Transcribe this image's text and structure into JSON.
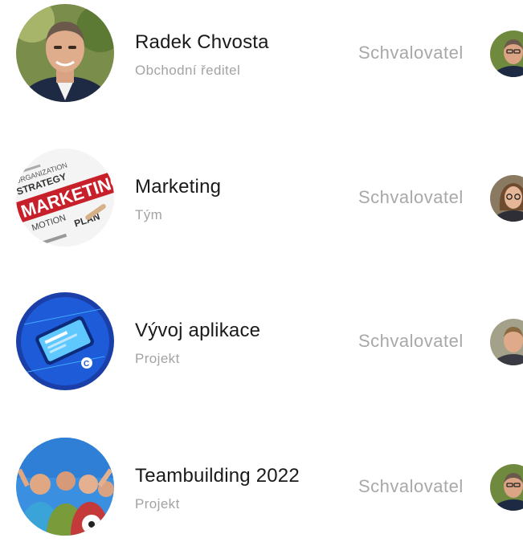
{
  "items": [
    {
      "title": "Radek Chvosta",
      "subtitle": "Obchodní ředitel",
      "role": "Schvalovatel",
      "avatar": "person-photo",
      "approver_avatar": "man-avatar"
    },
    {
      "title": "Marketing",
      "subtitle": "Tým",
      "role": "Schvalovatel",
      "avatar": "marketing-word-cloud",
      "approver_avatar": "woman-avatar",
      "avatar_words": [
        "MARKETING",
        "STRATEGY",
        "ORGANIZATION",
        "PLAN",
        "MOTION"
      ]
    },
    {
      "title": "Vývoj aplikace",
      "subtitle": "Projekt",
      "role": "Schvalovatel",
      "avatar": "phone-app-illustration",
      "approver_avatar": "man-avatar"
    },
    {
      "title": "Teambuilding 2022",
      "subtitle": "Projekt",
      "role": "Schvalovatel",
      "avatar": "team-photo",
      "approver_avatar": "man-avatar"
    }
  ],
  "colors": {
    "title": "#1a1a1a",
    "subtitle": "#a3a3a3",
    "role": "#a8a8a8",
    "marketing_red": "#c8202a",
    "app_blue": "#1e5bd8",
    "sky_blue": "#3b8fe0"
  }
}
